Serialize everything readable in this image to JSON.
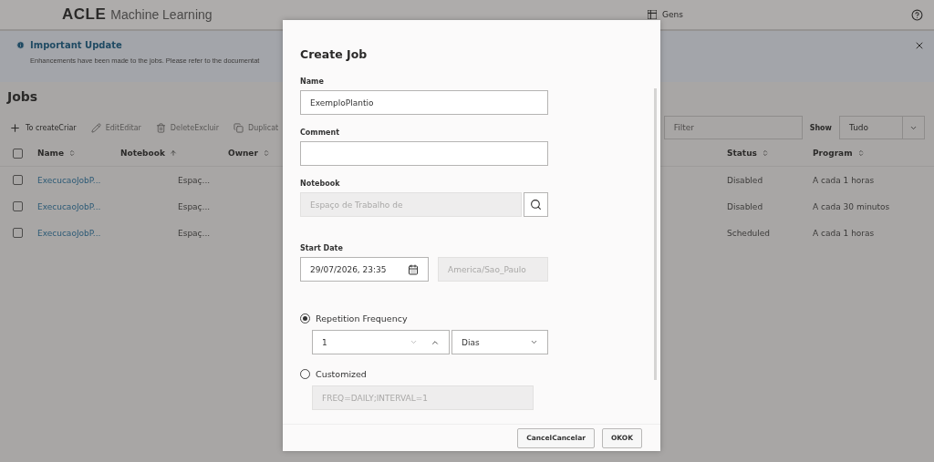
{
  "header": {
    "brand": "ACLE",
    "product": "Machine Learning",
    "menu_label": "Gens"
  },
  "banner": {
    "title": "Important Update",
    "message": "Enhancements have been made to the jobs. Please refer to the documentat"
  },
  "page_title": "Jobs",
  "toolbar": [
    {
      "label": "To createCriar",
      "kind": "add",
      "disabled": false
    },
    {
      "label": "EditEditar",
      "kind": "edit",
      "disabled": true
    },
    {
      "label": "DeleteExcluir",
      "kind": "delete",
      "disabled": true
    },
    {
      "label": "Duplicat",
      "kind": "copy",
      "disabled": true
    }
  ],
  "filter": {
    "placeholder": "Filter"
  },
  "show": {
    "label": "Show",
    "value": "Tudo"
  },
  "table": {
    "select_all_checked": false,
    "columns": [
      {
        "label": "Name",
        "sorted": false
      },
      {
        "label": "Notebook",
        "sorted": true
      },
      {
        "label": "Owner",
        "sorted": false
      },
      {
        "label": "Status",
        "sorted": false
      },
      {
        "label": "Program",
        "sorted": false
      }
    ],
    "rows": [
      {
        "checked": false,
        "name": "ExecucaoJobP...",
        "notebook": "Espaç...",
        "status": "Disabled",
        "program": "A cada 1 horas"
      },
      {
        "checked": false,
        "name": "ExecucaoJobP...",
        "notebook": "Espaç...",
        "status": "Disabled",
        "program": "A cada 30 minutos"
      },
      {
        "checked": false,
        "name": "ExecucaoJobP...",
        "notebook": "Espaç...",
        "status": "Scheduled",
        "program": "A cada 1 horas"
      }
    ]
  },
  "dialog": {
    "title": "Create Job",
    "name": {
      "label": "Name",
      "value": "ExemploPlantio"
    },
    "comment": {
      "label": "Comment"
    },
    "notebook": {
      "label": "Notebook",
      "placeholder": "Espaço de Trabalho de"
    },
    "start_date": {
      "label": "Start Date",
      "value": "29/07/2026, 23:35",
      "timezone": "America/Sao_Paulo"
    },
    "repetition": {
      "label": "Repetition Frequency",
      "selected": true,
      "value": "1",
      "unit": "Dias"
    },
    "customized": {
      "label": "Customized",
      "selected": false,
      "placeholder": "FREQ=DAILY;INTERVAL=1"
    },
    "buttons": [
      "CancelCancelar",
      "OKOK"
    ]
  }
}
